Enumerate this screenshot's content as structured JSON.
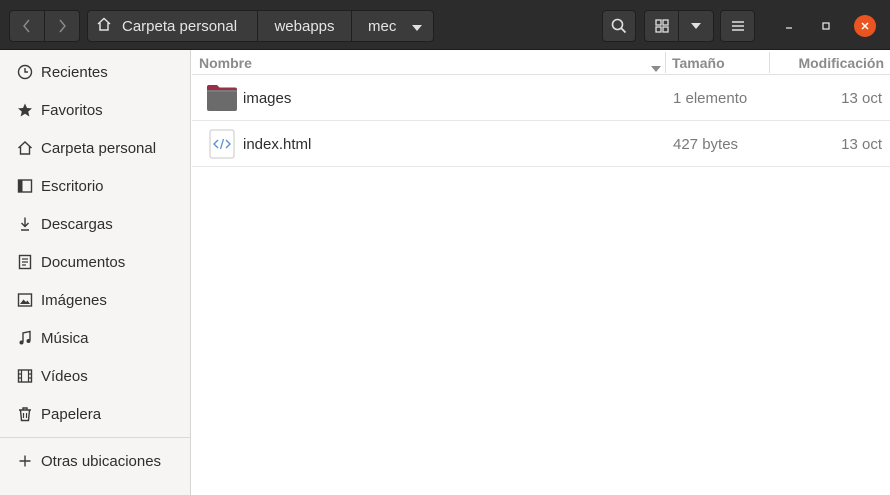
{
  "breadcrumb": [
    "Carpeta personal",
    "webapps",
    "mec"
  ],
  "sidebar": {
    "items": [
      {
        "label": "Recientes",
        "icon": "clock-icon"
      },
      {
        "label": "Favoritos",
        "icon": "star-icon"
      },
      {
        "label": "Carpeta personal",
        "icon": "home-icon"
      },
      {
        "label": "Escritorio",
        "icon": "desktop-icon"
      },
      {
        "label": "Descargas",
        "icon": "download-icon"
      },
      {
        "label": "Documentos",
        "icon": "document-icon"
      },
      {
        "label": "Imágenes",
        "icon": "picture-icon"
      },
      {
        "label": "Música",
        "icon": "music-icon"
      },
      {
        "label": "Vídeos",
        "icon": "video-icon"
      },
      {
        "label": "Papelera",
        "icon": "trash-icon"
      }
    ],
    "other": {
      "label": "Otras ubicaciones",
      "icon": "plus-icon"
    }
  },
  "columns": {
    "name": "Nombre",
    "size": "Tamaño",
    "modified": "Modificación"
  },
  "files": [
    {
      "name": "images",
      "size": "1 elemento",
      "modified": "13 oct",
      "type": "folder"
    },
    {
      "name": "index.html",
      "size": "427 bytes",
      "modified": "13 oct",
      "type": "html"
    }
  ],
  "colors": {
    "accent": "#e95420",
    "headerbar": "#2c2c2c",
    "sidebar": "#f6f5f4",
    "folder": "#6b6b6b",
    "folder_tab": "#9a2f47"
  }
}
